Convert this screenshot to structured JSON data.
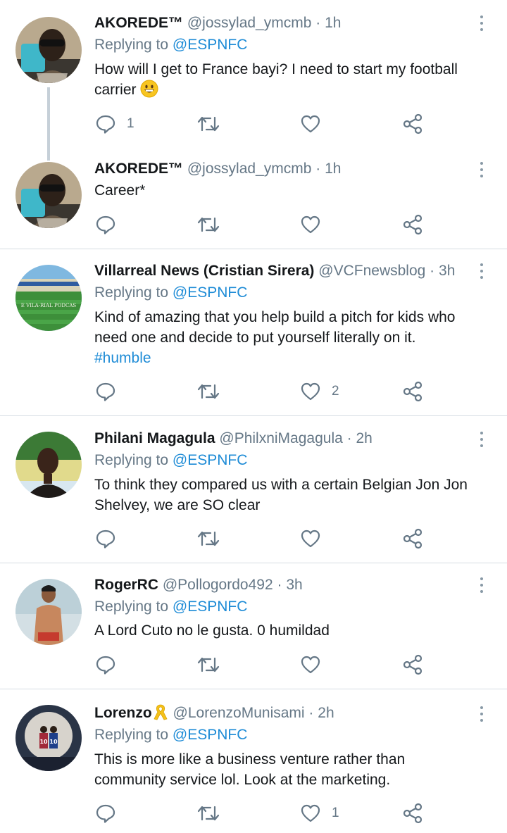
{
  "tweets": [
    {
      "name": "AKOREDE™",
      "handle": "@jossylad_ymcmb",
      "sep": "·",
      "time": "1h",
      "replying_prefix": "Replying to ",
      "replying_handle": "@ESPNFC",
      "text_line1": "How will I get to France bayi? I need to start my football",
      "text_line2": "carrier",
      "emoji": "grinning-face",
      "reply_count": "1",
      "like_count": ""
    },
    {
      "name": "AKOREDE™",
      "handle": "@jossylad_ymcmb",
      "sep": "·",
      "time": "1h",
      "text_line1": "Career*",
      "reply_count": "",
      "like_count": ""
    },
    {
      "name": "Villarreal News (Cristian Sirera)",
      "handle": "@VCFnewsblog",
      "sep": "·",
      "time": "3h",
      "replying_prefix": "Replying to ",
      "replying_handle": "@ESPNFC",
      "text_line1": "Kind of amazing that you help build a pitch for kids who",
      "text_line2": "need one and decide to put yourself literally on it.",
      "hashtag": "#humble",
      "avatar_caption": "E VILA-RIAL PODCAS",
      "reply_count": "",
      "like_count": "2"
    },
    {
      "name": "Philani Magagula",
      "handle": "@PhilxniMagagula",
      "sep": "·",
      "time": "2h",
      "replying_prefix": "Replying to ",
      "replying_handle": "@ESPNFC",
      "text_line1": "To think they compared us with a certain Belgian Jon Jon",
      "text_line2": "Shelvey, we are SO clear",
      "reply_count": "",
      "like_count": ""
    },
    {
      "name": "RogerRC",
      "handle": "@Pollogordo492",
      "sep": "·",
      "time": "3h",
      "replying_prefix": "Replying to ",
      "replying_handle": "@ESPNFC",
      "text_line1": "A Lord Cuto no le gusta. 0 humildad",
      "reply_count": "",
      "like_count": ""
    },
    {
      "name": "Lorenzo",
      "name_badge": "yellow-ribbon",
      "handle": "@LorenzoMunisami",
      "sep": "·",
      "time": "2h",
      "replying_prefix": "Replying to ",
      "replying_handle": "@ESPNFC",
      "text_line1": "This is more like a business venture rather than",
      "text_line2": "community service lol. Look at the marketing.",
      "avatar_caption": "10 10",
      "reply_count": "",
      "like_count": "1"
    }
  ],
  "icons": {
    "reply": "reply-icon",
    "retweet": "retweet-icon",
    "like": "like-icon",
    "share": "share-icon",
    "more": "more-options-icon"
  },
  "colors": {
    "link": "#1d8bd6",
    "secondary_text": "#657786",
    "icon": "#657786",
    "divider": "#d6dde3"
  }
}
